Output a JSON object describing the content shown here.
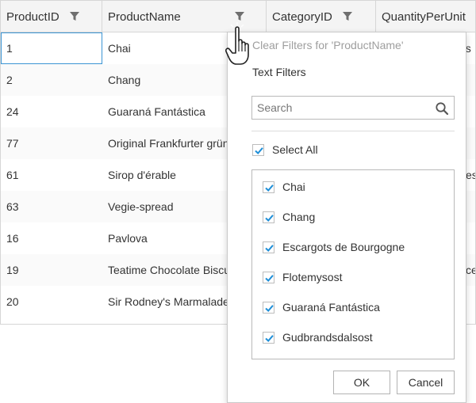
{
  "grid": {
    "columns": [
      {
        "label": "ProductID"
      },
      {
        "label": "ProductName"
      },
      {
        "label": "CategoryID"
      },
      {
        "label": "QuantityPerUnit"
      }
    ],
    "rows": [
      {
        "id": "1",
        "name": "Chai",
        "tail": "gs"
      },
      {
        "id": "2",
        "name": "Chang",
        "tail": ""
      },
      {
        "id": "24",
        "name": "Guaraná Fantástica",
        "tail": ""
      },
      {
        "id": "77",
        "name": "Original Frankfurter grün",
        "tail": ""
      },
      {
        "id": "61",
        "name": "Sirop d'érable",
        "tail": "es"
      },
      {
        "id": "63",
        "name": "Vegie-spread",
        "tail": ""
      },
      {
        "id": "16",
        "name": "Pavlova",
        "tail": ""
      },
      {
        "id": "19",
        "name": "Teatime Chocolate Biscuits",
        "tail": "ce"
      },
      {
        "id": "20",
        "name": "Sir Rodney's Marmalade",
        "tail": ""
      }
    ]
  },
  "filter_menu": {
    "clear_filters": "Clear Filters for 'ProductName'",
    "text_filters": "Text Filters",
    "search_placeholder": "Search",
    "select_all": "Select All",
    "items": [
      {
        "label": "Chai",
        "checked": true
      },
      {
        "label": "Chang",
        "checked": true
      },
      {
        "label": "Escargots de Bourgogne",
        "checked": true
      },
      {
        "label": "Flotemysost",
        "checked": true
      },
      {
        "label": "Guaraná Fantástica",
        "checked": true
      },
      {
        "label": "Gudbrandsdalsost",
        "checked": true
      }
    ],
    "ok_label": "OK",
    "cancel_label": "Cancel"
  },
  "colors": {
    "accent": "#1f8fd8",
    "header_bg": "#f4f4f4",
    "border": "#d6d6d6"
  },
  "icons": [
    "filter-icon",
    "search-icon",
    "checkmark-icon",
    "hand-pointer-icon"
  ]
}
